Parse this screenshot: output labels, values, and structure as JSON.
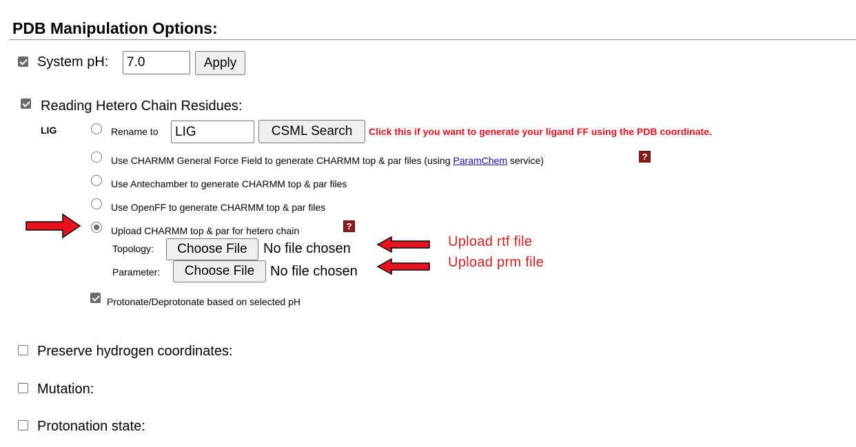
{
  "section_title": "PDB Manipulation Options:",
  "system_ph": {
    "label": "System pH:",
    "value": "7.0",
    "apply_label": "Apply",
    "checked": true
  },
  "hetero": {
    "label": "Reading Hetero Chain Residues:",
    "checked": true,
    "chain_id": "LIG",
    "rename": {
      "label": "Rename to",
      "value": "LIG",
      "button": "CSML Search",
      "note": "Click this if you want to generate your ligand FF using the PDB coordinate."
    },
    "cgenff": {
      "prefix": "Use CHARMM General Force Field to generate CHARMM top & par files (using",
      "link": "ParamChem",
      "suffix": "service)"
    },
    "antechamber": "Use Antechamber to generate CHARMM top & par files",
    "openff": "Use OpenFF to generate CHARMM top & par files",
    "upload": {
      "label": "Upload CHARMM top & par for hetero chain",
      "selected": true,
      "topology_label": "Topology:",
      "parameter_label": "Parameter:",
      "choose_file": "Choose File",
      "no_file": "No file chosen"
    },
    "protonate": {
      "label": "Protonate/Deprotonate based on selected pH",
      "checked": true
    }
  },
  "options": {
    "preserve_h": "Preserve hydrogen coordinates:",
    "mutation": "Mutation:",
    "protonation": "Protonation state:"
  },
  "annotations": {
    "rtf": "Upload rtf file",
    "prm": "Upload prm file",
    "arrow_color": "#e8111f",
    "help_icon_color": "#8b1a1a",
    "link_color": "#1a0dab"
  }
}
